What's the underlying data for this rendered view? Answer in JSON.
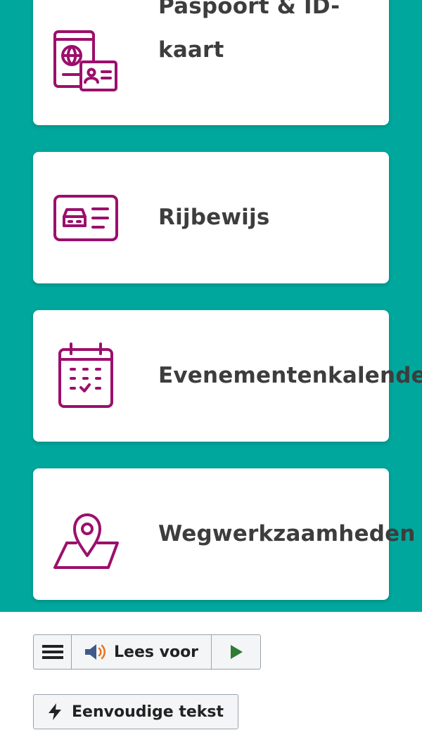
{
  "theme": {
    "background": "#00a79d",
    "accent_icon": "#9c0f6c"
  },
  "cards": [
    {
      "label": "Paspoort & ID-kaart",
      "icon": "passport-id-icon"
    },
    {
      "label": "Rijbewijs",
      "icon": "drivers-license-icon"
    },
    {
      "label": "Evenementenkalender",
      "icon": "calendar-icon"
    },
    {
      "label": "Wegwerkzaamheden",
      "icon": "map-pin-icon"
    }
  ],
  "readspeaker": {
    "menu_icon": "hamburger-icon",
    "lees_label": "Lees voor",
    "speaker_icon": "speaker-icon",
    "play_icon": "play-icon"
  },
  "simple_text": {
    "label": "Eenvoudige tekst",
    "icon": "lightning-icon"
  }
}
